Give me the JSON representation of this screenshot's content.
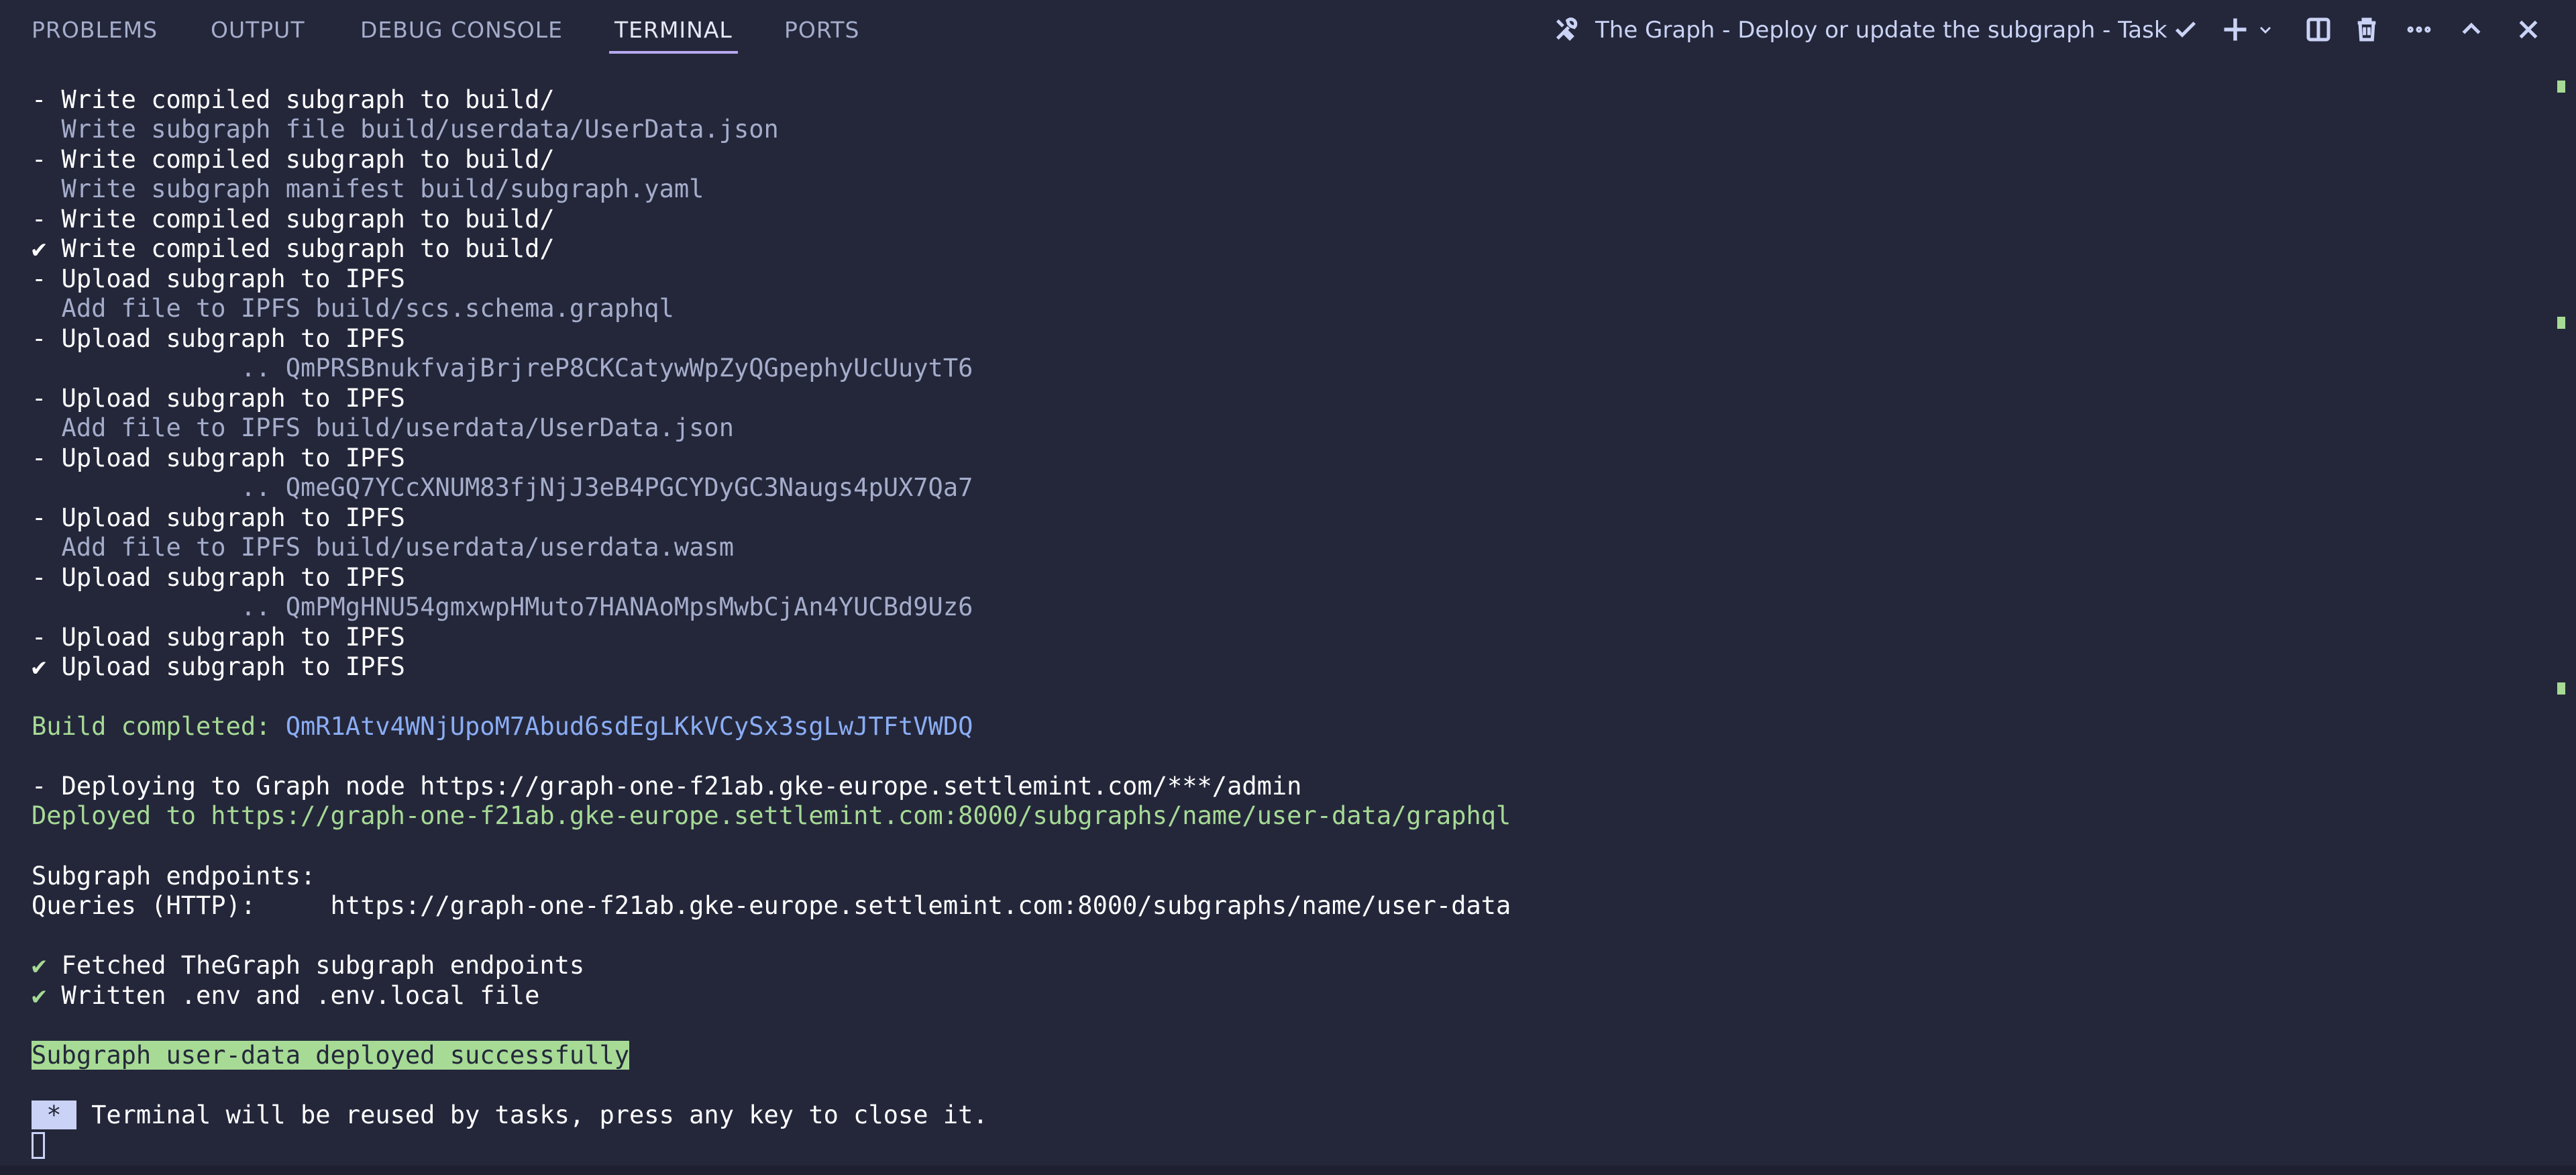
{
  "panel": {
    "tabs": [
      {
        "label": "PROBLEMS"
      },
      {
        "label": "OUTPUT"
      },
      {
        "label": "DEBUG CONSOLE"
      },
      {
        "label": "TERMINAL"
      },
      {
        "label": "PORTS"
      }
    ],
    "active_tab": "TERMINAL",
    "task_title": "The Graph - Deploy or update the subgraph - Task",
    "icons": [
      "tools-icon",
      "check-icon",
      "plus-icon",
      "chevron-down-icon",
      "split-icon",
      "trash-icon",
      "more-icon",
      "chevron-up-icon",
      "close-icon"
    ]
  },
  "terminal": {
    "lines": [
      "- Write compiled subgraph to build/",
      "  Write subgraph file build/userdata/UserData.json",
      "- Write compiled subgraph to build/",
      "  Write subgraph manifest build/subgraph.yaml",
      "- Write compiled subgraph to build/",
      "✔ Write compiled subgraph to build/",
      "- Upload subgraph to IPFS",
      "  Add file to IPFS build/scs.schema.graphql",
      "- Upload subgraph to IPFS",
      "              .. QmPRSBnukfvajBrjreP8CKCatywWpZyQGpephyUcUuytT6",
      "- Upload subgraph to IPFS",
      "  Add file to IPFS build/userdata/UserData.json",
      "- Upload subgraph to IPFS",
      "              .. QmeGQ7YCcXNUM83fjNjJ3eB4PGCYDyGC3Naugs4pUX7Qa7",
      "- Upload subgraph to IPFS",
      "  Add file to IPFS build/userdata/userdata.wasm",
      "- Upload subgraph to IPFS",
      "              .. QmPMgHNU54gmxwpHMuto7HANAoMpsMwbCjAn4YUCBd9Uz6",
      "- Upload subgraph to IPFS",
      "✔ Upload subgraph to IPFS"
    ],
    "build_label": "Build completed: ",
    "build_hash": "QmR1Atv4WNjUpoM7Abud6sdEgLKkVCySx3sgLwJTFtVWDQ",
    "deploying": "- Deploying to Graph node https://graph-one-f21ab.gke-europe.settlemint.com/***/admin",
    "deployed": "Deployed to https://graph-one-f21ab.gke-europe.settlemint.com:8000/subgraphs/name/user-data/graphql",
    "endpoints_title": "Subgraph endpoints:",
    "queries": "Queries (HTTP):     https://graph-one-f21ab.gke-europe.settlemint.com:8000/subgraphs/name/user-data",
    "check_mark": "✔",
    "fetched": " Fetched TheGraph subgraph endpoints",
    "written": " Written .env and .env.local file",
    "success": "Subgraph user-data deployed successfully",
    "reuse_badge": " * ",
    "reuse_text": " Terminal will be reused by tasks, press any key to close it."
  }
}
